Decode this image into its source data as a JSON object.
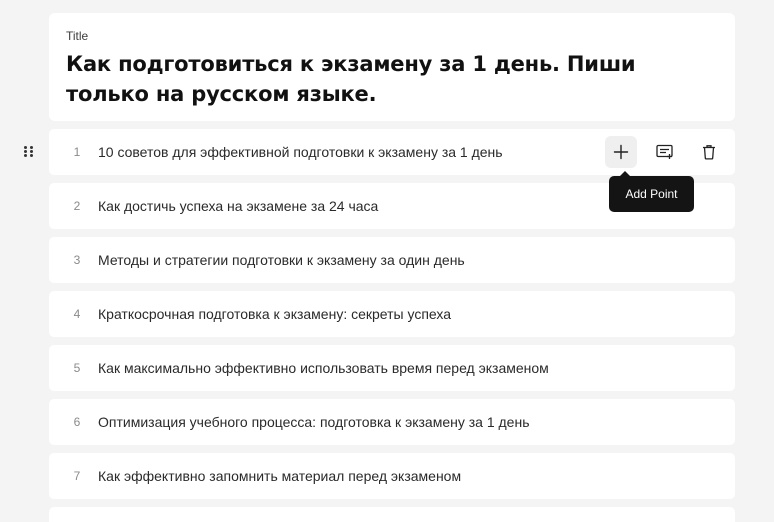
{
  "title_section": {
    "label": "Title",
    "text": "Как подготовиться к экзамену за 1 день. Пиши только на русском языке."
  },
  "points": [
    {
      "number": "1",
      "text": "10 советов для эффективной подготовки к экзамену за 1 день"
    },
    {
      "number": "2",
      "text": "Как достичь успеха на экзамене за 24 часа"
    },
    {
      "number": "3",
      "text": "Методы и стратегии подготовки к экзамену за один день"
    },
    {
      "number": "4",
      "text": "Краткосрочная подготовка к экзамену: секреты успеха"
    },
    {
      "number": "5",
      "text": "Как максимально эффективно использовать время перед экзаменом"
    },
    {
      "number": "6",
      "text": "Оптимизация учебного процесса: подготовка к экзамену за 1 день"
    },
    {
      "number": "7",
      "text": "Как эффективно запомнить материал перед экзаменом"
    }
  ],
  "row_actions": {
    "add_icon": "plus-icon",
    "note_icon": "note-add-icon",
    "delete_icon": "trash-icon"
  },
  "tooltip": {
    "text": "Add Point"
  }
}
